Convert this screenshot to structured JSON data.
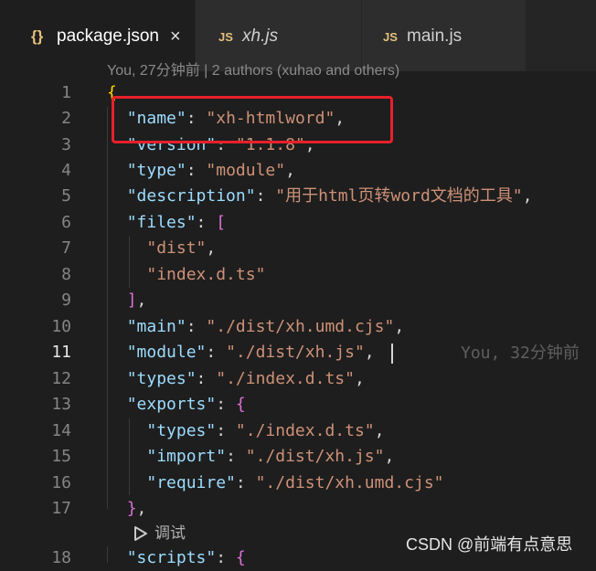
{
  "tabs": [
    {
      "icon": "{}",
      "label": "package.json",
      "active": true,
      "close": "×"
    },
    {
      "icon": "JS",
      "label": "xh.js",
      "active": false
    },
    {
      "icon": "JS",
      "label": "main.js",
      "active": false
    }
  ],
  "blame_header": "You, 27分钟前 | 2 authors (xuhao and others)",
  "current_line": 11,
  "lines": [
    {
      "n": 1,
      "tokens": [
        [
          "{",
          "br1"
        ]
      ]
    },
    {
      "n": 2,
      "tokens": [
        [
          "  ",
          "punc"
        ],
        [
          "\"name\"",
          "key"
        ],
        [
          ": ",
          "punc"
        ],
        [
          "\"xh-htmlword\"",
          "str"
        ],
        [
          ",",
          "punc"
        ]
      ]
    },
    {
      "n": 3,
      "tokens": [
        [
          "  ",
          "punc"
        ],
        [
          "\"version\"",
          "key"
        ],
        [
          ": ",
          "punc"
        ],
        [
          "\"1.1.8\"",
          "str"
        ],
        [
          ",",
          "punc"
        ]
      ]
    },
    {
      "n": 4,
      "tokens": [
        [
          "  ",
          "punc"
        ],
        [
          "\"type\"",
          "key"
        ],
        [
          ": ",
          "punc"
        ],
        [
          "\"module\"",
          "str"
        ],
        [
          ",",
          "punc"
        ]
      ]
    },
    {
      "n": 5,
      "tokens": [
        [
          "  ",
          "punc"
        ],
        [
          "\"description\"",
          "key"
        ],
        [
          ": ",
          "punc"
        ],
        [
          "\"用于html页转word文档的工具\"",
          "str"
        ],
        [
          ",",
          "punc"
        ]
      ]
    },
    {
      "n": 6,
      "tokens": [
        [
          "  ",
          "punc"
        ],
        [
          "\"files\"",
          "key"
        ],
        [
          ": ",
          "punc"
        ],
        [
          "[",
          "br2"
        ]
      ]
    },
    {
      "n": 7,
      "tokens": [
        [
          "    ",
          "punc"
        ],
        [
          "\"dist\"",
          "str"
        ],
        [
          ",",
          "punc"
        ]
      ]
    },
    {
      "n": 8,
      "tokens": [
        [
          "    ",
          "punc"
        ],
        [
          "\"index.d.ts\"",
          "str"
        ]
      ]
    },
    {
      "n": 9,
      "tokens": [
        [
          "  ",
          "punc"
        ],
        [
          "]",
          "br2"
        ],
        [
          ",",
          "punc"
        ]
      ]
    },
    {
      "n": 10,
      "tokens": [
        [
          "  ",
          "punc"
        ],
        [
          "\"main\"",
          "key"
        ],
        [
          ": ",
          "punc"
        ],
        [
          "\"./dist/xh.umd.cjs\"",
          "str"
        ],
        [
          ",",
          "punc"
        ]
      ]
    },
    {
      "n": 11,
      "tokens": [
        [
          "  ",
          "punc"
        ],
        [
          "\"module\"",
          "key"
        ],
        [
          ": ",
          "punc"
        ],
        [
          "\"./dist/xh.js\"",
          "str"
        ],
        [
          ",",
          "punc"
        ]
      ]
    },
    {
      "n": 12,
      "tokens": [
        [
          "  ",
          "punc"
        ],
        [
          "\"types\"",
          "key"
        ],
        [
          ": ",
          "punc"
        ],
        [
          "\"./index.d.ts\"",
          "str"
        ],
        [
          ",",
          "punc"
        ]
      ]
    },
    {
      "n": 13,
      "tokens": [
        [
          "  ",
          "punc"
        ],
        [
          "\"exports\"",
          "key"
        ],
        [
          ": ",
          "punc"
        ],
        [
          "{",
          "br2"
        ]
      ]
    },
    {
      "n": 14,
      "tokens": [
        [
          "    ",
          "punc"
        ],
        [
          "\"types\"",
          "key"
        ],
        [
          ": ",
          "punc"
        ],
        [
          "\"./index.d.ts\"",
          "str"
        ],
        [
          ",",
          "punc"
        ]
      ]
    },
    {
      "n": 15,
      "tokens": [
        [
          "    ",
          "punc"
        ],
        [
          "\"import\"",
          "key"
        ],
        [
          ": ",
          "punc"
        ],
        [
          "\"./dist/xh.js\"",
          "str"
        ],
        [
          ",",
          "punc"
        ]
      ]
    },
    {
      "n": 16,
      "tokens": [
        [
          "    ",
          "punc"
        ],
        [
          "\"require\"",
          "key"
        ],
        [
          ": ",
          "punc"
        ],
        [
          "\"./dist/xh.umd.cjs\"",
          "str"
        ]
      ]
    },
    {
      "n": 17,
      "tokens": [
        [
          "  ",
          "punc"
        ],
        [
          "}",
          "br2"
        ],
        [
          ",",
          "punc"
        ]
      ]
    },
    {
      "n": 18,
      "tokens": [
        [
          "  ",
          "punc"
        ],
        [
          "\"scripts\"",
          "key"
        ],
        [
          ": ",
          "punc"
        ],
        [
          "{",
          "br2"
        ]
      ]
    }
  ],
  "inline_blame": "You, 32分钟前",
  "codelens": {
    "label": "调试"
  },
  "watermark": "CSDN @前端有点意思",
  "colors": {
    "key": "#9cdcfe",
    "string": "#ce9178",
    "bracket_level1": "#ffd700",
    "bracket_level2": "#da70d6",
    "highlight_box": "#e8202a",
    "json_icon": "#e5c07b",
    "js_icon": "#e5c07b"
  },
  "icons": {
    "json_tab": "json-braces-icon",
    "js_tab": "javascript-icon",
    "close": "close-icon",
    "debug": "play-icon"
  }
}
